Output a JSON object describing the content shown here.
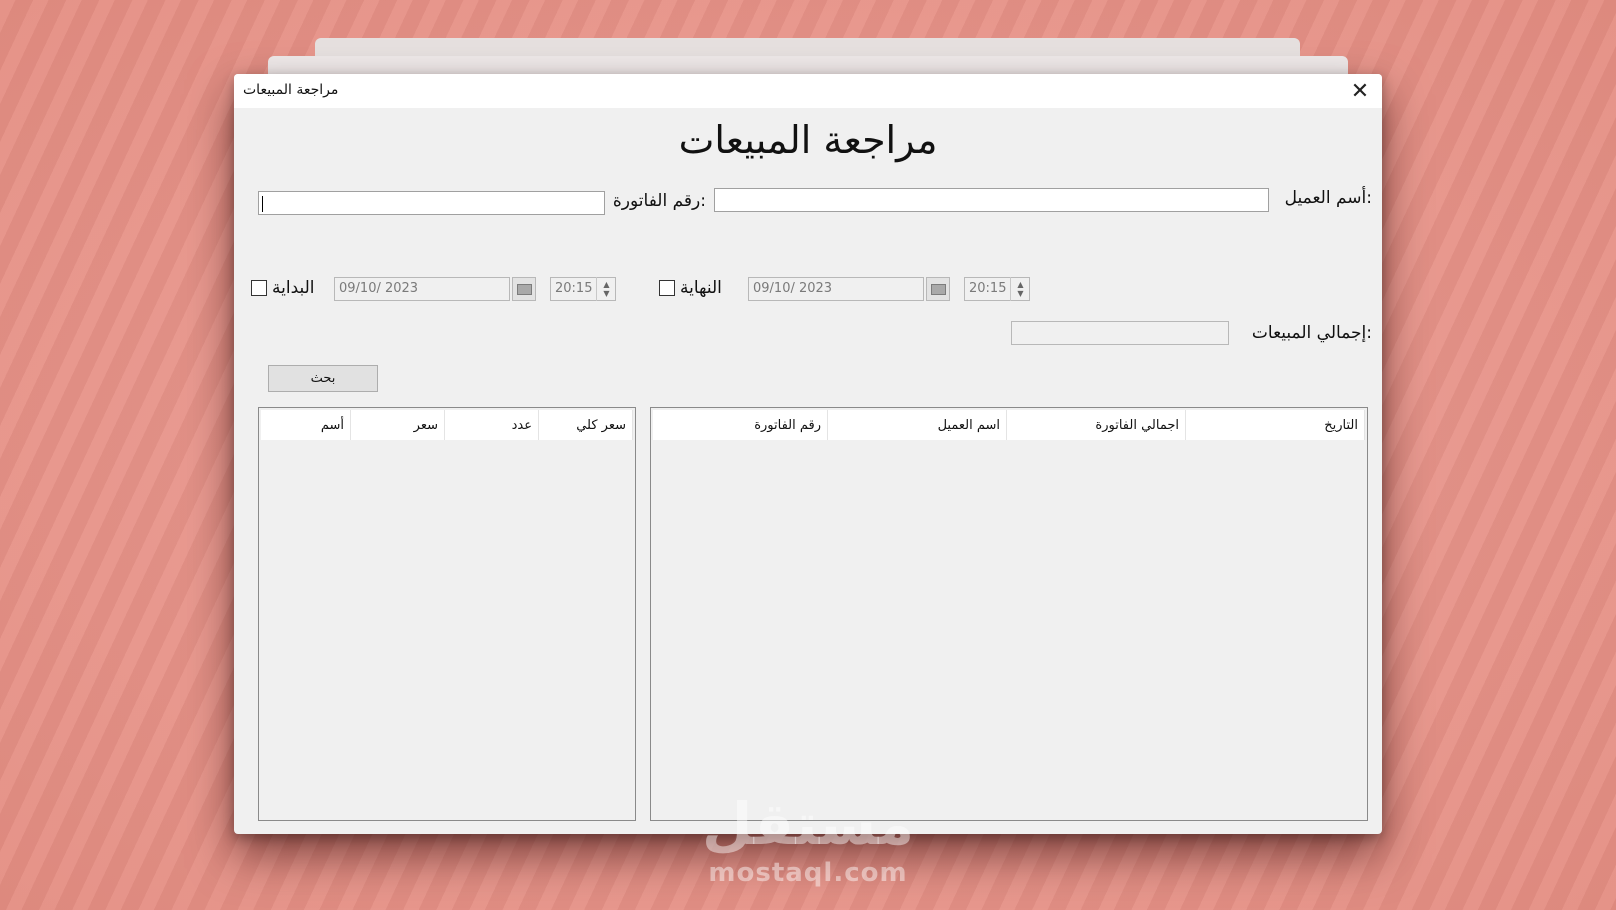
{
  "window": {
    "title": "مراجعة المبيعات",
    "close_icon": "close-icon"
  },
  "heading": "مراجعة المبيعات",
  "customer": {
    "label": "أسم العميل:",
    "value": ""
  },
  "invoice": {
    "label": "رقم الفاتورة:",
    "value": ""
  },
  "end": {
    "label": "النهاية",
    "checked": false,
    "date": "09/10/ 2023",
    "time": "20:15"
  },
  "start": {
    "label": "البداية",
    "checked": false,
    "date": "09/10/ 2023",
    "time": "20:15"
  },
  "total": {
    "label": "إجمالي المبيعات:",
    "value": ""
  },
  "search_button": "بحث",
  "invoices_grid": {
    "columns": [
      "التاريخ",
      "اجمالي الفاتورة",
      "اسم العميل",
      "رقم الفاتورة"
    ]
  },
  "items_grid": {
    "columns": [
      "سعر كلي",
      "عدد",
      "سعر",
      "أسم"
    ]
  },
  "watermark": {
    "logo": "مستقل",
    "url": "mostaql.com"
  }
}
